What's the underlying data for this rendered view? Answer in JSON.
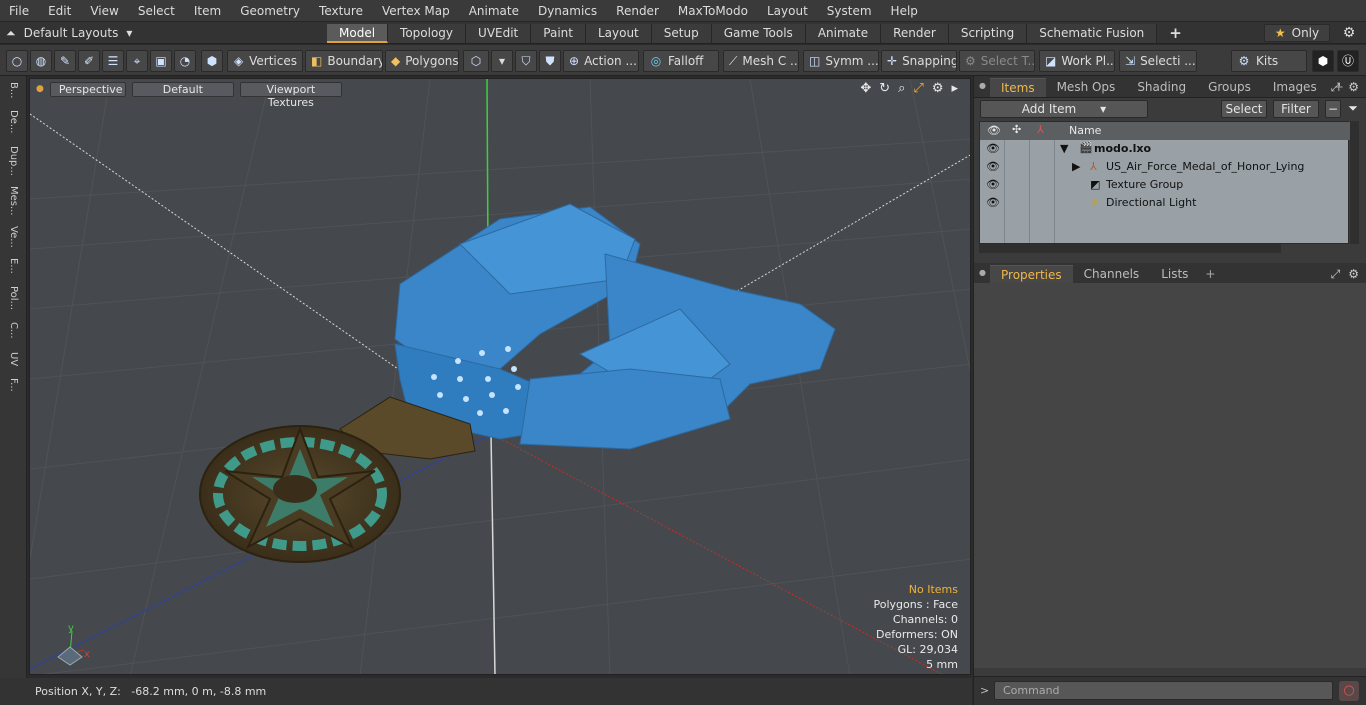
{
  "menubar": [
    "File",
    "Edit",
    "View",
    "Select",
    "Item",
    "Geometry",
    "Texture",
    "Vertex Map",
    "Animate",
    "Dynamics",
    "Render",
    "MaxToModo",
    "Layout",
    "System",
    "Help"
  ],
  "layout": {
    "label": "Default Layouts"
  },
  "tabs": [
    "Model",
    "Topology",
    "UVEdit",
    "Paint",
    "Layout",
    "Setup",
    "Game Tools",
    "Animate",
    "Render",
    "Scripting",
    "Schematic Fusion"
  ],
  "active_tab": "Model",
  "only_label": "Only",
  "toolbar": {
    "vertices": "Vertices",
    "boundary": "Boundary",
    "polygons": "Polygons",
    "action": "Action ...",
    "falloff": "Falloff",
    "mesh": "Mesh C ...",
    "symm": "Symm ...",
    "snapping": "Snapping",
    "select_t": "Select T...",
    "workpl": "Work Pl...",
    "selecti": "Selecti ...",
    "kits": "Kits"
  },
  "left_tabs": [
    "B...",
    "De...",
    "Dup...",
    "Mes...",
    "Ve...",
    "E...",
    "Pol...",
    "C...",
    "UV",
    "F..."
  ],
  "viewport": {
    "view": "Perspective",
    "shading": "Default",
    "textures": "Viewport Textures",
    "hud": {
      "no_items": "No Items",
      "polygons": "Polygons : Face",
      "channels": "Channels: 0",
      "deformers": "Deformers: ON",
      "gl": "GL: 29,034",
      "scale": "5 mm"
    }
  },
  "status": {
    "position": "Position X, Y, Z:   -68.2 mm, 0 m, -8.8 mm"
  },
  "items_panel": {
    "tabs": [
      "Items",
      "Mesh Ops",
      "Shading",
      "Groups",
      "Images"
    ],
    "add_item": "Add Item",
    "select": "Select",
    "filter": "Filter",
    "col_name": "Name",
    "rows": [
      "modo.lxo",
      "US_Air_Force_Medal_of_Honor_Lying",
      "Texture Group",
      "Directional Light"
    ]
  },
  "props_panel": {
    "tabs": [
      "Properties",
      "Channels",
      "Lists"
    ]
  },
  "command": {
    "placeholder": "Command"
  },
  "colors": {
    "accent": "#e2a23a",
    "ribbon": "#3a86c8",
    "grid_bg": "#45494d"
  }
}
